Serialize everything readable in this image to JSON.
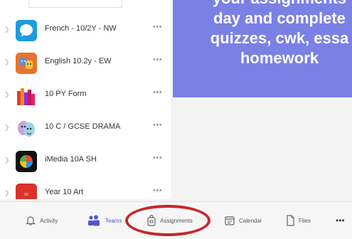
{
  "teams": [
    {
      "name": "French - 10/2Y - NW",
      "icon": "chat-bubble-icon",
      "color": "#2aa0e0"
    },
    {
      "name": "English 10.2y - EW",
      "icon": "theatre-masks-icon",
      "color": "#e8732a"
    },
    {
      "name": "10 PY Form",
      "icon": "color-bars-icon",
      "color": "#d43a2f"
    },
    {
      "name": "10 C / GCSE DRAMA",
      "icon": "drama-masks-icon",
      "color": "#c9a3e0"
    },
    {
      "name": "iMedia 10A SH",
      "icon": "colorful-circle-icon",
      "color": "#222222"
    },
    {
      "name": "Year 10 Art",
      "icon": "red-square-icon",
      "color": "#d9322c"
    }
  ],
  "banner": {
    "line1": "your assignments",
    "line2": "day and complete",
    "line3": "quizzes, cwk, essa",
    "line4": "homework"
  },
  "nav": {
    "activity": "Activity",
    "teams": "Teams",
    "assignments": "Assignments",
    "calendar": "Calendar",
    "files": "Files",
    "more": "•••"
  },
  "colors": {
    "accent": "#7b80e5",
    "highlight": "#c62828"
  }
}
